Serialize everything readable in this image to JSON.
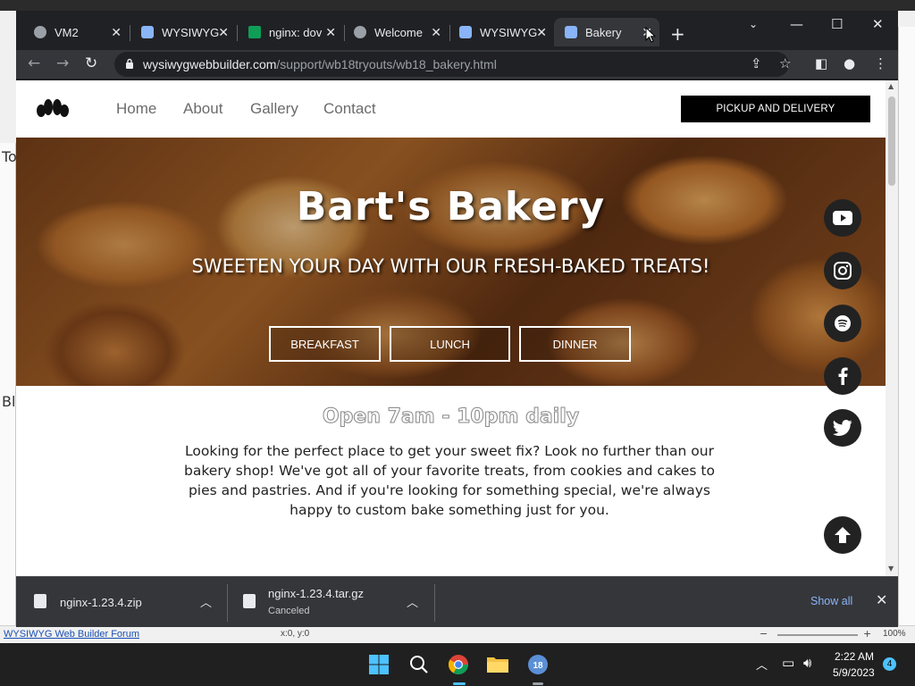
{
  "browser": {
    "tabs": [
      {
        "label": "VM2",
        "icon": "globe-icon"
      },
      {
        "label": "WYSIWYG",
        "icon": "wysiwyg-icon"
      },
      {
        "label": "nginx: dov",
        "icon": "nginx-icon"
      },
      {
        "label": "Welcome",
        "icon": "globe-icon"
      },
      {
        "label": "WYSIWYG",
        "icon": "wysiwyg-icon"
      },
      {
        "label": "Bakery",
        "icon": "wysiwyg-icon",
        "active": true
      }
    ],
    "url": {
      "domain": "wysiwygwebbuilder.com",
      "path": "/support/wb18tryouts/wb18_bakery.html"
    }
  },
  "site": {
    "nav": {
      "links": [
        "Home",
        "About",
        "Gallery",
        "Contact"
      ],
      "cta": "PICKUP AND DELIVERY"
    },
    "hero": {
      "title": "Bart's Bakery",
      "subtitle": "SWEETEN YOUR DAY WITH OUR FRESH-BAKED TREATS!",
      "buttons": [
        "BREAKFAST",
        "LUNCH",
        "DINNER"
      ]
    },
    "social": [
      "youtube-icon",
      "instagram-icon",
      "spotify-icon",
      "facebook-icon",
      "twitter-icon"
    ],
    "hours": "Open 7am - 10pm daily",
    "intro": "Looking for the perfect place to get your sweet fix? Look no further than our bakery shop! We've got all of your favorite treats, from cookies and cakes to pies and pastries. And if you're looking for something special, we're always happy to custom bake something just for you."
  },
  "downloads": {
    "items": [
      {
        "name": "nginx-1.23.4.zip",
        "status": ""
      },
      {
        "name": "nginx-1.23.4.tar.gz",
        "status": "Canceled"
      }
    ],
    "show_all": "Show all"
  },
  "background_app": {
    "forum_link": "WYSIWYG Web Builder Forum",
    "coords": "x:0, y:0",
    "zoom": "100%",
    "left_letters": [
      "To",
      "Bl"
    ]
  },
  "taskbar": {
    "time": "2:22 AM",
    "date": "5/9/2023",
    "notifications": "4"
  },
  "colors": {
    "chrome_dark": "#202124",
    "chrome_toolbar": "#35363a",
    "accent_link": "#8ab4f8",
    "cta_bg": "#000000"
  }
}
